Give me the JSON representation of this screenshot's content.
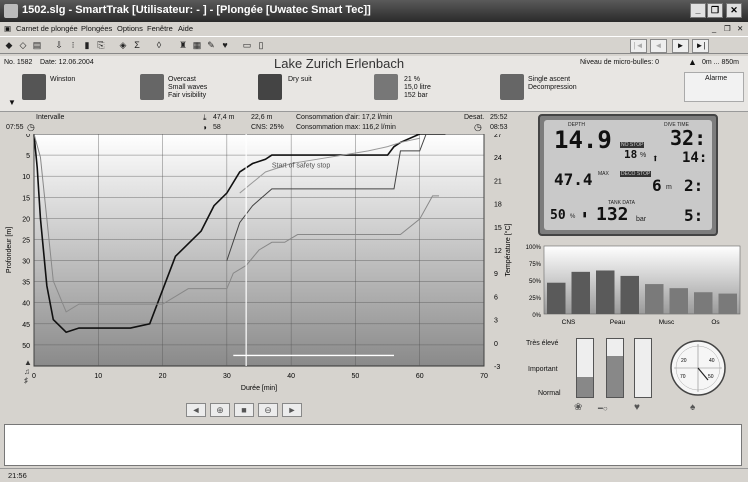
{
  "window": {
    "title": "1502.slg - SmartTrak [Utilisateur: - ] - [Plongée [Uwatec Smart Tec]]"
  },
  "menu": [
    "Carnet de plongée",
    "Plongées",
    "Options",
    "Fenêtre",
    "Aide"
  ],
  "dive": {
    "number": "No. 1582",
    "date": "Date: 12.06.2004",
    "location": "Lake Zurich   Erlenbach",
    "microbubble": "Niveau de micro-bulles: 0",
    "altitude": "0m ... 850m",
    "alarm": "Alarme"
  },
  "info": {
    "buddy": "Winston",
    "weather": [
      "Overcast",
      "Small waves",
      "Fair visibility"
    ],
    "suit": "Dry suit",
    "gas": [
      "21 %",
      "15,0 litre",
      "152 bar"
    ],
    "profile": [
      "Single ascent",
      "Decompression"
    ]
  },
  "stats": {
    "interval_label": "Intervalle",
    "entry_time": "07:55",
    "max_depth": "47,4 m",
    "avg_depth": "22,6 m",
    "water_temp": "58",
    "cns": "CNS: 25%",
    "air_consumption": "Consommation d'air: 17,2 l/min",
    "max_consumption": "Consommation max: 116,2 l/min",
    "desat_label": "Desat.",
    "desat_time": "25:52",
    "end_time": "08:53"
  },
  "chart_data": {
    "type": "line",
    "xlabel": "Durée [min]",
    "ylabel": "Profondeur [m]",
    "y2label": "Température [°C]",
    "xlim": [
      0,
      70
    ],
    "ylim": [
      0,
      55
    ],
    "y2lim": [
      -3,
      27
    ],
    "xticks": [
      0,
      10,
      20,
      30,
      40,
      50,
      60,
      70
    ],
    "yticks": [
      0,
      5,
      10,
      15,
      20,
      25,
      30,
      35,
      40,
      45,
      50
    ],
    "y2ticks": [
      27,
      24,
      21,
      18,
      15,
      12,
      9,
      6,
      3,
      0,
      -3
    ],
    "annotation": "Start of safety stop",
    "series": [
      {
        "key": "depth",
        "color": "#111111",
        "x": [
          0,
          0.5,
          1,
          2,
          3,
          5,
          7,
          9,
          12,
          15,
          18,
          19,
          20,
          21,
          22,
          24,
          26,
          28,
          30,
          32,
          34,
          36,
          37,
          40,
          44,
          48,
          52,
          55,
          56,
          57,
          60,
          63,
          64
        ],
        "y": [
          0,
          8,
          20,
          36,
          44,
          47,
          46,
          46,
          46,
          46,
          45,
          41,
          37,
          33,
          29,
          26,
          23,
          17,
          14,
          9,
          7,
          6,
          5,
          5,
          5,
          5,
          5,
          5,
          3,
          2,
          0,
          0,
          0
        ]
      },
      {
        "key": "depth-alt",
        "color": "#444444",
        "x": [
          30,
          32,
          34,
          37,
          40,
          44,
          48,
          52,
          56,
          57,
          60,
          61
        ],
        "y": [
          30,
          21,
          17,
          13,
          13,
          13,
          13,
          13,
          13,
          4,
          4,
          0
        ]
      },
      {
        "key": "temperature",
        "color": "#888888",
        "x": [
          0,
          1,
          2,
          3,
          5,
          7,
          10,
          14,
          18,
          20,
          22,
          24,
          26,
          28,
          30,
          31,
          33,
          35,
          37,
          39,
          41,
          43,
          46,
          50,
          54,
          57,
          60,
          62,
          63
        ],
        "y": [
          27,
          24,
          16,
          8,
          4,
          5,
          5,
          5,
          5,
          5,
          6,
          7,
          7,
          7,
          7,
          9,
          10,
          12,
          13,
          13,
          14,
          14,
          14,
          14,
          14,
          14,
          16,
          19,
          19
        ]
      },
      {
        "key": "ascent-rate",
        "color": "#999999",
        "x": [
          32,
          36,
          40,
          44,
          48,
          52,
          55,
          57,
          60
        ],
        "y": [
          14,
          9,
          7,
          6,
          5,
          4,
          3,
          2,
          1
        ]
      }
    ]
  },
  "playback": [
    "◄",
    "⊕",
    "■",
    "⊖",
    "►"
  ],
  "lcd": {
    "depth": "14.9",
    "depth_label": "DEPTH",
    "dive_time": "32:",
    "dive_time_label": "DIVE TIME",
    "no_stop": "NO STOP",
    "percent": "18",
    "stop_time": "14:",
    "max_label": "MAX",
    "max": "47.4",
    "deco_label": "DECO STOP",
    "deco_depth": "6",
    "deco_unit": "m",
    "deco_time": "2:",
    "tank_label": "TANK DATA",
    "o2": "50",
    "pressure": "132",
    "pressure_unit": "bar",
    "remaining": "5:"
  },
  "tissue_chart": {
    "type": "bar",
    "categories": [
      "CNS",
      "Peau",
      "Musc",
      "Os"
    ],
    "values": [
      46,
      62,
      64,
      56,
      44,
      38,
      32,
      30
    ],
    "ylim": [
      0,
      100
    ],
    "yticks": [
      "100%",
      "75%",
      "50%",
      "25%",
      "0%"
    ]
  },
  "workload": {
    "labels": [
      "Très élevé",
      "Important",
      "Normal"
    ],
    "levels": [
      0.35,
      0.7,
      0.0
    ]
  },
  "statusbar": {
    "time": "21:56"
  }
}
